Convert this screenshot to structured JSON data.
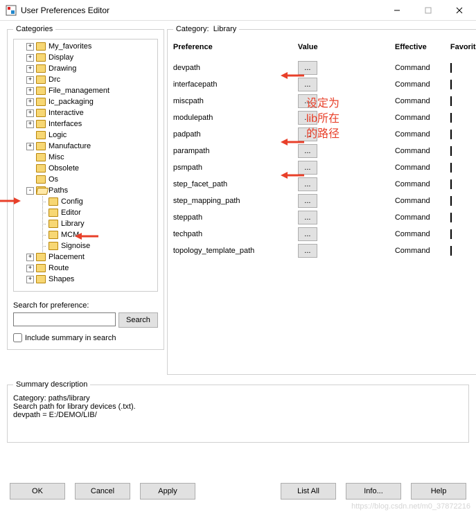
{
  "window": {
    "title": "User Preferences Editor",
    "min_label": "—",
    "max_label": "▢",
    "close_label": "✕"
  },
  "categories": {
    "legend": "Categories",
    "tree": [
      {
        "d": 1,
        "exp": "+",
        "open": false,
        "label": "My_favorites"
      },
      {
        "d": 1,
        "exp": "+",
        "open": false,
        "label": "Display"
      },
      {
        "d": 1,
        "exp": "+",
        "open": false,
        "label": "Drawing"
      },
      {
        "d": 1,
        "exp": "+",
        "open": false,
        "label": "Drc"
      },
      {
        "d": 1,
        "exp": "+",
        "open": false,
        "label": "File_management"
      },
      {
        "d": 1,
        "exp": "+",
        "open": false,
        "label": "Ic_packaging"
      },
      {
        "d": 1,
        "exp": "+",
        "open": false,
        "label": "Interactive"
      },
      {
        "d": 1,
        "exp": "+",
        "open": false,
        "label": "Interfaces"
      },
      {
        "d": 1,
        "exp": " ",
        "open": false,
        "label": "Logic"
      },
      {
        "d": 1,
        "exp": "+",
        "open": false,
        "label": "Manufacture"
      },
      {
        "d": 1,
        "exp": " ",
        "open": false,
        "label": "Misc"
      },
      {
        "d": 1,
        "exp": " ",
        "open": false,
        "label": "Obsolete"
      },
      {
        "d": 1,
        "exp": " ",
        "open": false,
        "label": "Os"
      },
      {
        "d": 1,
        "exp": "-",
        "open": true,
        "label": "Paths"
      },
      {
        "d": 2,
        "exp": "c",
        "open": false,
        "label": "Config"
      },
      {
        "d": 2,
        "exp": "c",
        "open": false,
        "label": "Editor"
      },
      {
        "d": 2,
        "exp": "c",
        "open": false,
        "label": "Library"
      },
      {
        "d": 2,
        "exp": "c",
        "open": false,
        "label": "MCM"
      },
      {
        "d": 2,
        "exp": "c",
        "open": false,
        "label": "Signoise"
      },
      {
        "d": 1,
        "exp": "+",
        "open": false,
        "label": "Placement"
      },
      {
        "d": 1,
        "exp": "+",
        "open": false,
        "label": "Route"
      },
      {
        "d": 1,
        "exp": "+",
        "open": false,
        "label": "Shapes"
      }
    ]
  },
  "search": {
    "label": "Search for preference:",
    "value": "",
    "button": "Search",
    "include_label": "Include summary in search",
    "include_checked": false
  },
  "right": {
    "header_label": "Category:",
    "header_value": "Library",
    "columns": {
      "pref": "Preference",
      "val": "Value",
      "eff": "Effective",
      "fav": "Favorite"
    },
    "ellipsis": "...",
    "rows": [
      {
        "name": "devpath",
        "effective": "Command"
      },
      {
        "name": "interfacepath",
        "effective": "Command"
      },
      {
        "name": "miscpath",
        "effective": "Command"
      },
      {
        "name": "modulepath",
        "effective": "Command"
      },
      {
        "name": "padpath",
        "effective": "Command"
      },
      {
        "name": "parampath",
        "effective": "Command"
      },
      {
        "name": "psmpath",
        "effective": "Command"
      },
      {
        "name": "step_facet_path",
        "effective": "Command"
      },
      {
        "name": "step_mapping_path",
        "effective": "Command"
      },
      {
        "name": "steppath",
        "effective": "Command"
      },
      {
        "name": "techpath",
        "effective": "Command"
      },
      {
        "name": "topology_template_path",
        "effective": "Command"
      }
    ]
  },
  "summary": {
    "legend": "Summary description",
    "lines": [
      "Category: paths/library",
      "Search path for library devices (.txt).",
      "devpath = E:/DEMO/LIB/"
    ]
  },
  "buttons": {
    "ok": "OK",
    "cancel": "Cancel",
    "apply": "Apply",
    "list_all": "List All",
    "info": "Info...",
    "help": "Help"
  },
  "watermark": "https://blog.csdn.net/m0_37872216",
  "annotation": {
    "text_lines": [
      "设定为",
      "lib所在",
      "的路径"
    ]
  }
}
